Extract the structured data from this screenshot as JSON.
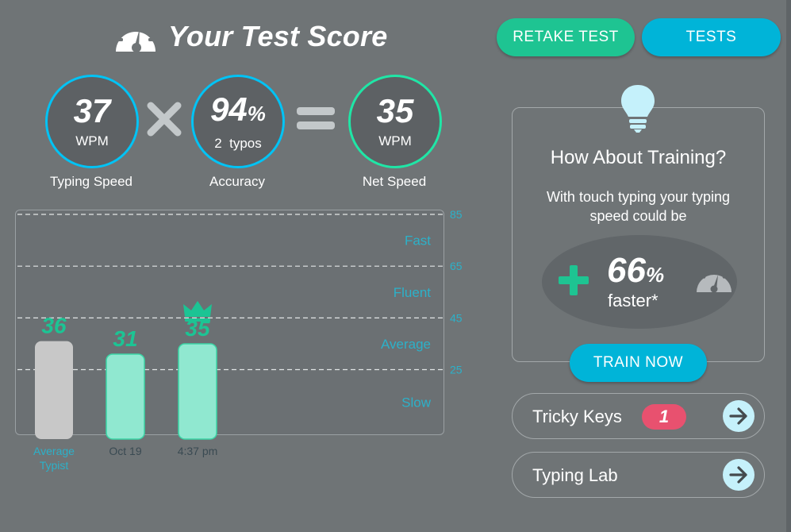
{
  "header": {
    "title": "Your Test Score",
    "icon": "speedometer-icon",
    "retake_label": "RETAKE TEST",
    "tests_label": "TESTS"
  },
  "stats": {
    "speed": {
      "value": "37",
      "unit": "WPM",
      "label": "Typing Speed"
    },
    "operator1": "times-icon",
    "accuracy": {
      "value": "94",
      "suffix": "%",
      "sub": "2  typos",
      "label": "Accuracy"
    },
    "operator2": "equals-icon",
    "net": {
      "value": "35",
      "unit": "WPM",
      "label": "Net Speed"
    }
  },
  "chart_data": {
    "type": "bar",
    "categories": [
      "Average Typist",
      "Oct 19",
      "4:37 pm"
    ],
    "values": [
      36,
      31,
      35
    ],
    "value_labels": [
      "36",
      "31",
      "35"
    ],
    "ylim": [
      0,
      85
    ],
    "gridlines": [
      85,
      65,
      45,
      25
    ],
    "bands": [
      "Fast",
      "Fluent",
      "Average",
      "Slow"
    ],
    "highlight": "crown-icon",
    "grid": true,
    "colors": {
      "average": "#c8c8c8",
      "result": "#90e8d0",
      "value_text": "#1cc494",
      "axis_text": "#2cb1c9"
    }
  },
  "training": {
    "icon": "lightbulb-icon",
    "title": "How About Training?",
    "text": "With touch typing your typing speed could be",
    "plus_icon": "plus-icon",
    "percent": "66",
    "percent_suffix": "%",
    "faster": "faster*",
    "gauge_icon": "speedometer-icon",
    "button": "TRAIN NOW"
  },
  "links": [
    {
      "label": "Tricky Keys",
      "badge": "1",
      "icon": "arrow-right-icon"
    },
    {
      "label": "Typing Lab",
      "icon": "arrow-right-icon"
    }
  ],
  "colors": {
    "background": "#6f7476",
    "teal": "#1ec492",
    "blue": "#00b4d8",
    "badge": "#e8516f"
  }
}
